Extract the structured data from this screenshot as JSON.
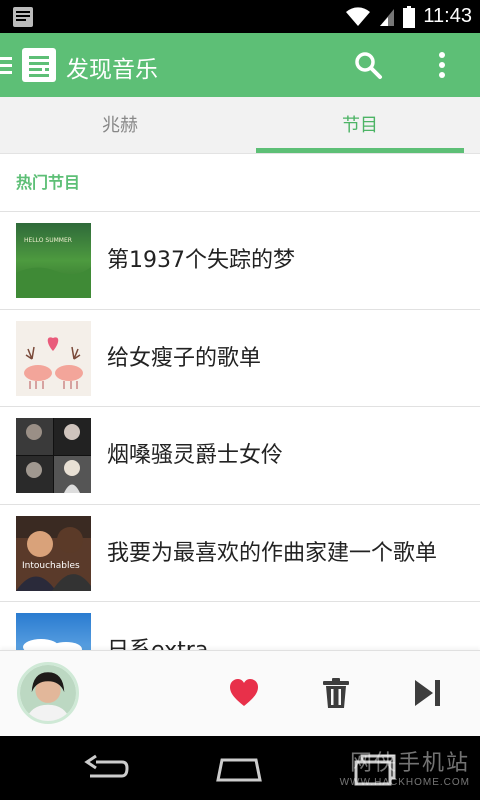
{
  "status_bar": {
    "time": "11:43"
  },
  "app_bar": {
    "title": "发现音乐"
  },
  "tabs": [
    {
      "label": "兆赫",
      "active": false
    },
    {
      "label": "节目",
      "active": true
    }
  ],
  "section": {
    "title": "热门节目"
  },
  "programs": [
    {
      "title": "第1937个失踪的梦",
      "cover_text": "HELLO SUMMER"
    },
    {
      "title": "给女瘦子的歌单"
    },
    {
      "title": "烟嗓骚灵爵士女伶"
    },
    {
      "title": "我要为最喜欢的作曲家建一个歌单",
      "cover_text": "Intouchables"
    },
    {
      "title": "日系extra"
    }
  ],
  "player": {
    "like_color": "#e8304a"
  },
  "watermark": {
    "line1": "网侠手机站",
    "line2": "WWW.HACKHOME.COM"
  },
  "colors": {
    "accent": "#5dbf76"
  }
}
